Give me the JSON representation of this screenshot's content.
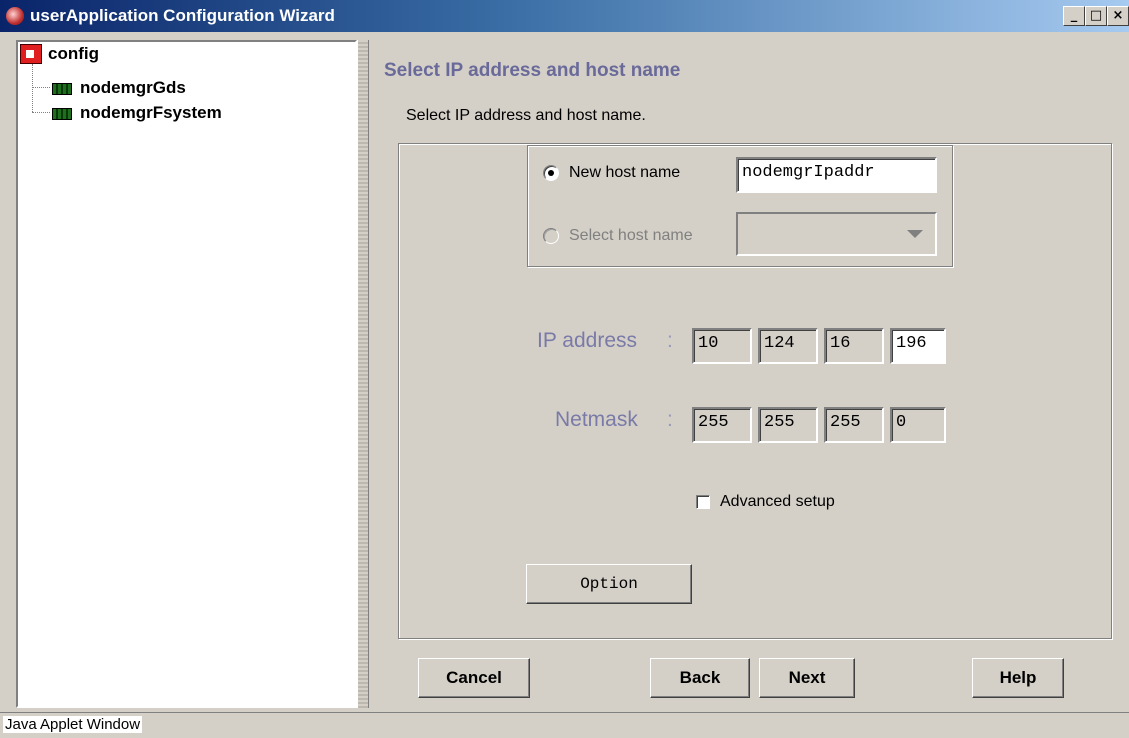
{
  "window": {
    "title": "userApplication Configuration Wizard",
    "controls": {
      "minimize": "_",
      "maximize": "□",
      "close": "×"
    }
  },
  "tree": {
    "root": {
      "label": "config",
      "icon": "config-folder-icon"
    },
    "children": [
      {
        "label": "nodemgrGds",
        "icon": "resource-icon"
      },
      {
        "label": "nodemgrFsystem",
        "icon": "resource-icon"
      }
    ]
  },
  "main": {
    "heading": "Select IP address and host name",
    "subheading": "Select IP address and host name.",
    "host": {
      "new_label": "New host name",
      "new_value": "nodemgrIpaddr",
      "new_selected": true,
      "select_label": "Select host name",
      "select_value": ""
    },
    "ip": {
      "label": "IP address",
      "colon": ":",
      "octets": [
        "10",
        "124",
        "16",
        "196"
      ]
    },
    "netmask": {
      "label": "Netmask",
      "colon": ":",
      "octets": [
        "255",
        "255",
        "255",
        "0"
      ]
    },
    "advanced": {
      "label": "Advanced setup",
      "checked": false
    },
    "option_label": "Option"
  },
  "buttons": {
    "cancel": "Cancel",
    "back": "Back",
    "next": "Next",
    "help": "Help"
  },
  "status": {
    "text": "Java Applet Window"
  },
  "colors": {
    "titlebar_start": "#0a246a",
    "titlebar_end": "#a6caf0",
    "heading": "#6a6a9a",
    "field_label": "#7a7aa8",
    "window_bg": "#d4d0c8"
  }
}
